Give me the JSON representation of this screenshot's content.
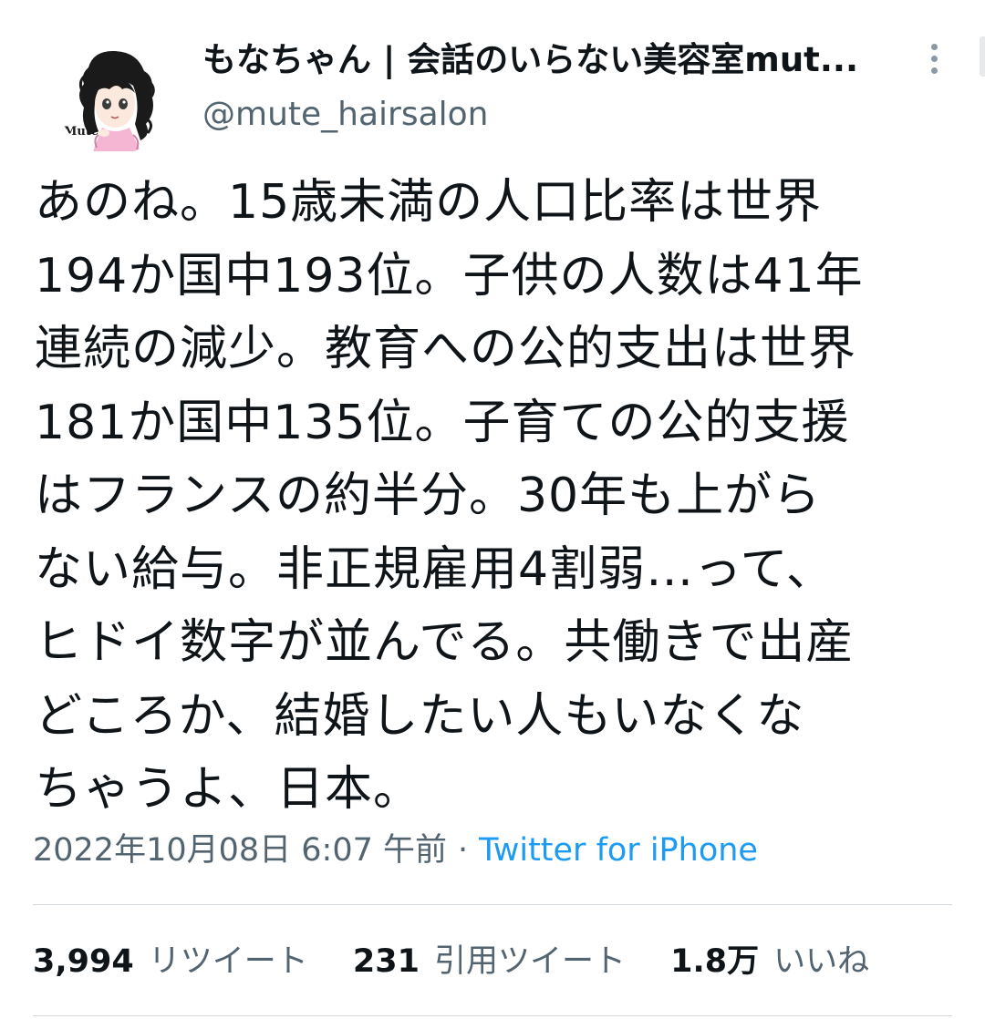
{
  "author": {
    "display_name": "もなちゃん | 会話のいらない美容室mut...",
    "handle": "@mute_hairsalon",
    "avatar_logo_text": "Mute"
  },
  "tweet": {
    "text": "あのね。15歳未満の人口比率は世界\n194か国中193位。子供の人数は41年\n連続の減少。教育への公的支出は世界\n181か国中135位。子育ての公的支援\nはフランスの約半分。30年も上がら\nない給与。非正規雇用4割弱…って、\nヒドイ数字が並んでる。共働きで出産\nどころか、結婚したい人もいなくな\nちゃうよ、日本。",
    "timestamp": "2022年10月08日 6:07 午前",
    "separator": "·",
    "source": "Twitter for iPhone"
  },
  "stats": {
    "retweets": {
      "count": "3,994",
      "label": "リツイート"
    },
    "quotes": {
      "count": "231",
      "label": "引用ツイート"
    },
    "likes": {
      "count": "1.8万",
      "label": "いいね"
    }
  },
  "colors": {
    "text_primary": "#0f1419",
    "text_secondary": "#536471",
    "link": "#1d9bf0",
    "divider": "#d4d9dd"
  },
  "icons": {
    "more": "more-vertical-icon"
  }
}
